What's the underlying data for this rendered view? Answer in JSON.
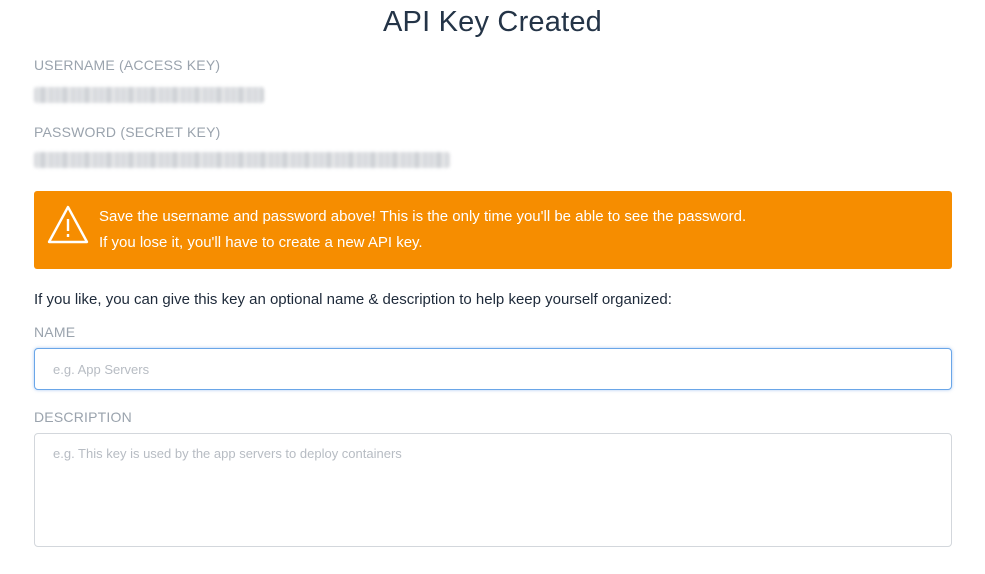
{
  "page": {
    "title": "API Key Created"
  },
  "credentials": {
    "username_label": "USERNAME (ACCESS KEY)",
    "password_label": "PASSWORD (SECRET KEY)"
  },
  "warning": {
    "line1": "Save the username and password above! This is the only time you'll be able to see the password.",
    "line2": "If you lose it, you'll have to create a new API key.",
    "icon": "warning-triangle-icon",
    "color": "#f68d00"
  },
  "form": {
    "helper_text": "If you like, you can give this key an optional name & description to help keep yourself organized:",
    "name_label": "NAME",
    "name_placeholder": "e.g. App Servers",
    "name_value": "",
    "description_label": "DESCRIPTION",
    "description_placeholder": "e.g. This key is used by the app servers to deploy containers",
    "description_value": ""
  },
  "colors": {
    "focus_border": "#6aa6e8",
    "label_gray": "#9aa3ad"
  }
}
